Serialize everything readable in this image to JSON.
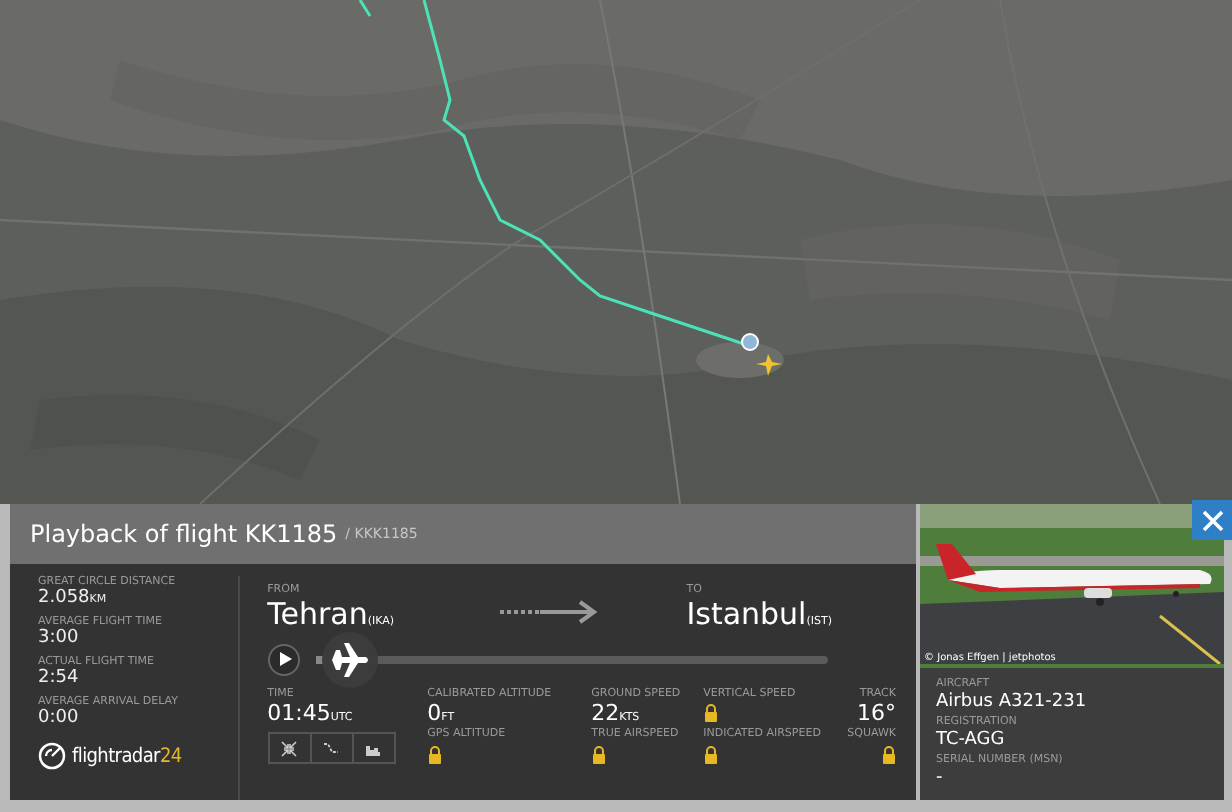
{
  "panel": {
    "title": "Playback of flight KK1185",
    "callsign": "/ KKK1185"
  },
  "stats": [
    {
      "label": "GREAT CIRCLE DISTANCE",
      "value": "2.058",
      "unit": "KM"
    },
    {
      "label": "AVERAGE FLIGHT TIME",
      "value": "3:00"
    },
    {
      "label": "ACTUAL FLIGHT TIME",
      "value": "2:54"
    },
    {
      "label": "AVERAGE ARRIVAL DELAY",
      "value": "0:00"
    }
  ],
  "logo": {
    "text": "flightradar",
    "suffix": "24"
  },
  "route": {
    "from": {
      "label": "FROM",
      "city": "Tehran",
      "code": "(IKA)"
    },
    "to": {
      "label": "TO",
      "city": "Istanbul",
      "code": "(IST)"
    }
  },
  "playback": {
    "level": 0.03
  },
  "time": {
    "label": "TIME",
    "value": "01:45",
    "unit": "UTC"
  },
  "readouts": [
    {
      "label": "CALIBRATED ALTITUDE",
      "value": "0",
      "unit": "FT",
      "locked": false
    },
    {
      "label": "GROUND SPEED",
      "value": "22",
      "unit": "KTS",
      "locked": false
    },
    {
      "label": "VERTICAL SPEED",
      "locked": true
    },
    {
      "label": "TRACK",
      "value": "16°",
      "locked": false
    },
    {
      "label": "GPS ALTITUDE",
      "locked": true
    },
    {
      "label": "TRUE AIRSPEED",
      "locked": true
    },
    {
      "label": "INDICATED AIRSPEED",
      "locked": true
    },
    {
      "label": "SQUAWK",
      "locked": true
    }
  ],
  "aircraft": {
    "photo_credit": "© Jonas Effgen | jetphotos",
    "details": [
      {
        "label": "AIRCRAFT",
        "value": "Airbus A321-231"
      },
      {
        "label": "REGISTRATION",
        "value": "TC-AGG"
      },
      {
        "label": "SERIAL NUMBER (MSN)",
        "value": "-"
      }
    ]
  }
}
